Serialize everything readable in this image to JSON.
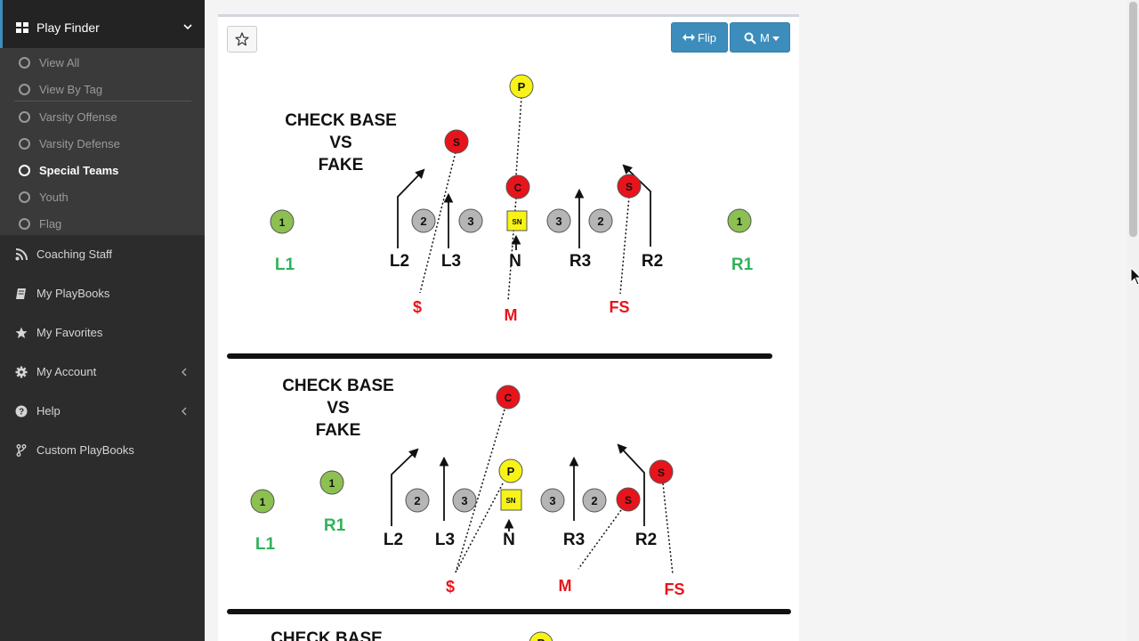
{
  "sidebar": {
    "play_finder": "Play Finder",
    "sub_items": [
      "View All",
      "View By Tag",
      "Varsity Offense",
      "Varsity Defense",
      "Special Teams",
      "Youth",
      "Flag"
    ],
    "active_item": "Special Teams",
    "nav": {
      "coaching_staff": "Coaching Staff",
      "my_playbooks": "My PlayBooks",
      "my_favorites": "My Favorites",
      "my_account": "My Account",
      "help": "Help",
      "custom_playbooks": "Custom PlayBooks"
    }
  },
  "toolbar": {
    "flip_label": "Flip",
    "zoom_label": "M"
  },
  "diagrams": [
    {
      "title_lines": [
        "CHECK BASE",
        "VS",
        "FAKE"
      ],
      "labels": [
        "L1",
        "L2",
        "L3",
        "N",
        "R3",
        "R2",
        "R1",
        "$",
        "M",
        "FS"
      ],
      "markers": [
        "P",
        "S",
        "C",
        "S",
        "SN",
        "1",
        "2",
        "3",
        "3",
        "2",
        "1"
      ]
    },
    {
      "title_lines": [
        "CHECK BASE",
        "VS",
        "FAKE"
      ],
      "labels": [
        "L1",
        "R1",
        "L2",
        "L3",
        "N",
        "R3",
        "R2",
        "$",
        "M",
        "FS"
      ],
      "markers": [
        "C",
        "P",
        "S",
        "S",
        "SN",
        "1",
        "1",
        "2",
        "3",
        "3",
        "2"
      ]
    },
    {
      "title_lines": [
        "CHECK BASE"
      ],
      "markers": [
        "P"
      ]
    }
  ],
  "colors": {
    "accent": "#3c8dbc",
    "sidebar_bg": "#2c2c2c",
    "defender_red": "#e8141c",
    "punter_yellow": "#f7f316",
    "lineman_green": "#8cc152",
    "blocker_gray": "#b5b5b5",
    "label_green": "#2fb35a",
    "label_red": "#e8141c"
  }
}
